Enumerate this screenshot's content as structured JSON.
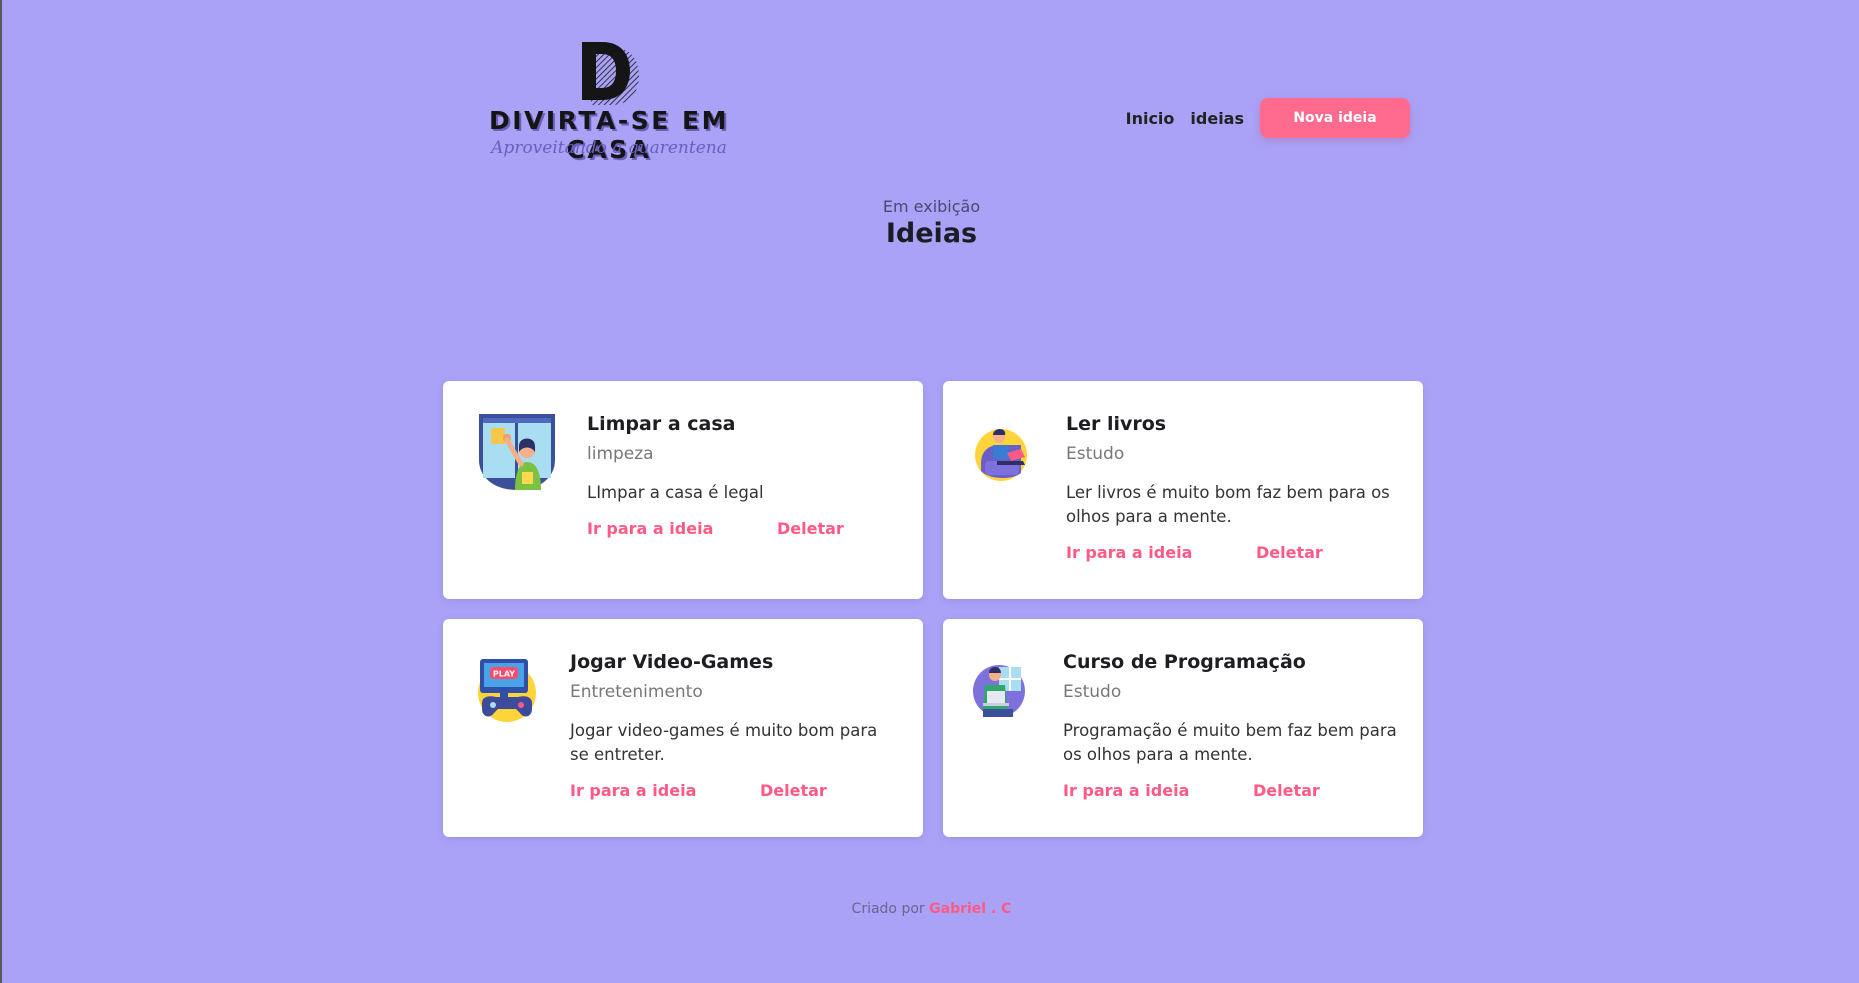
{
  "header": {
    "logo_title": "DIVIRTA-SE EM CASA",
    "logo_subtitle": "Aproveitando a quarentena",
    "nav": {
      "home_label": "Inicio",
      "ideas_label": "ideias",
      "new_idea_label": "Nova ideia"
    }
  },
  "section": {
    "subtitle": "Em exibição",
    "title": "Ideias"
  },
  "cards": [
    {
      "title": "Limpar a casa",
      "category": "limpeza",
      "description": "LImpar a casa é legal",
      "go_label": "Ir para a ideia",
      "delete_label": "Deletar",
      "icon": "cleaning-window-icon"
    },
    {
      "title": "Ler livros",
      "category": "Estudo",
      "description": "Ler livros é muito bom faz bem para os olhos para a mente.",
      "go_label": "Ir para a ideia",
      "delete_label": "Deletar",
      "icon": "reading-person-icon"
    },
    {
      "title": "Jogar Video-Games",
      "category": "Entretenimento",
      "description": "Jogar video-games é muito bom para se entreter.",
      "go_label": "Ir para a ideia",
      "delete_label": "Deletar",
      "icon": "play-controller-icon",
      "icon_text": "PLAY"
    },
    {
      "title": "Curso de Programação",
      "category": "Estudo",
      "description": "Programação é muito bem faz bem para os olhos para a mente.",
      "go_label": "Ir para a ideia",
      "delete_label": "Deletar",
      "icon": "programmer-laptop-icon"
    }
  ],
  "footer": {
    "prefix": "Criado por",
    "author": "Gabriel . C"
  },
  "colors": {
    "background": "#aaa2f6",
    "accent": "#ff5a85",
    "button": "#ff6a8e",
    "card": "#ffffff"
  }
}
